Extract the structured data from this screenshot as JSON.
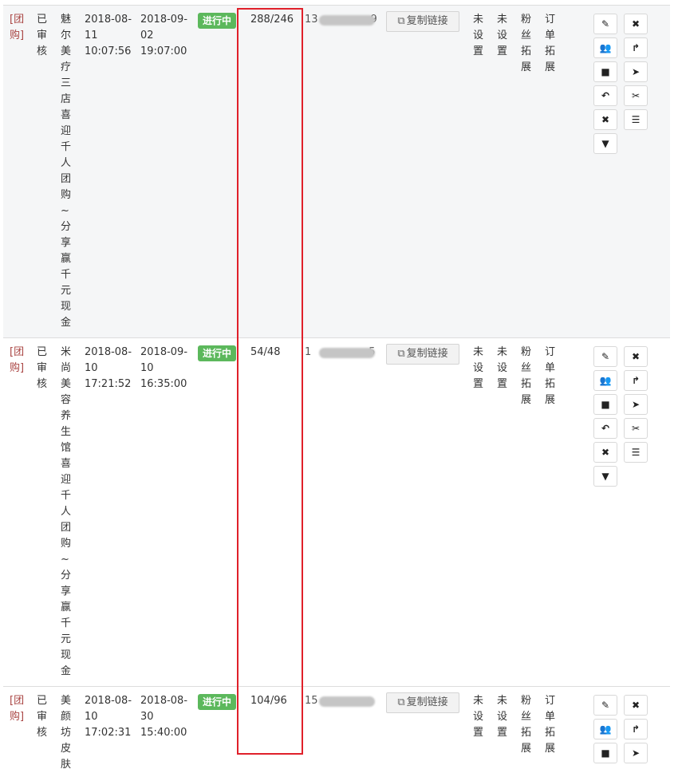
{
  "rows": [
    {
      "type_tag": "[团购]",
      "audit_status": "已审核",
      "title": "魅尔美疗三店喜迎千人团购~分享赢千元现金",
      "start_date": "2018-08-11",
      "start_time": "10:07:56",
      "end_date": "2018-09-02",
      "end_time": "19:07:00",
      "status_badge": "进行中",
      "count": "288/246",
      "phone_prefix": "13",
      "phone_suffix": "9",
      "copy_link_label": "复制链接",
      "col_a": "未设置",
      "col_b": "未设置",
      "col_c": "粉丝拓展",
      "col_d": "订单拓展"
    },
    {
      "type_tag": "[团购]",
      "audit_status": "已审核",
      "title": "米尚美容养生馆喜迎千人团购~分享赢千元现金",
      "start_date": "2018-08-10",
      "start_time": "17:21:52",
      "end_date": "2018-09-10",
      "end_time": "16:35:00",
      "status_badge": "进行中",
      "count": "54/48",
      "phone_prefix": "1",
      "phone_suffix": "5",
      "copy_link_label": "复制链接",
      "col_a": "未设置",
      "col_b": "未设置",
      "col_c": "粉丝拓展",
      "col_d": "订单拓展"
    },
    {
      "type_tag": "[团购]",
      "audit_status": "已审核",
      "title": "美颜坊皮肤",
      "start_date": "2018-08-10",
      "start_time": "17:02:31",
      "end_date": "2018-08-30",
      "end_time": "15:40:00",
      "status_badge": "进行中",
      "count": "104/96",
      "phone_prefix": "15",
      "phone_suffix": "",
      "copy_link_label": "复制链接",
      "col_a": "未设置",
      "col_b": "未设置",
      "col_c": "粉丝拓展",
      "col_d": "订单拓展"
    }
  ],
  "action_icons": [
    "edit-icon",
    "close-icon",
    "users-icon",
    "share-icon",
    "stop-icon",
    "send-icon",
    "reply-icon",
    "cut-icon",
    "delete-icon",
    "list-icon",
    "filter-icon"
  ],
  "colors": {
    "badge": "#5cb85c",
    "highlight": "#e0202a",
    "type_tag": "#a94442",
    "alt_row": "#f5f6f7"
  }
}
